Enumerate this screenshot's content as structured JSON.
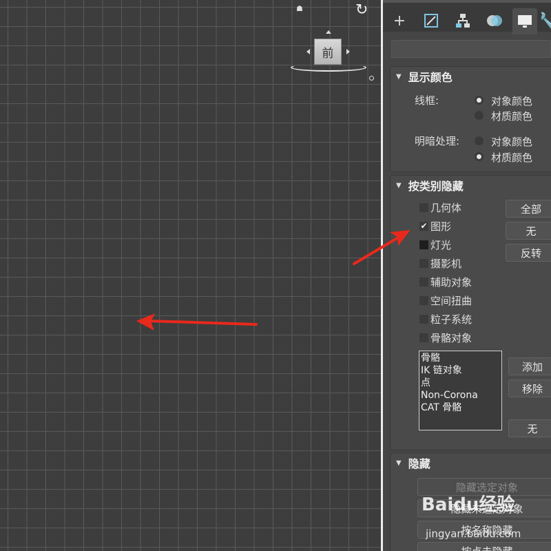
{
  "viewport": {
    "viewcube_face": "前"
  },
  "panel": {
    "display_color": {
      "title": "显示颜色",
      "wireframe_label": "线框:",
      "wireframe_options": [
        "对象颜色",
        "材质颜色"
      ],
      "wireframe_selected": 0,
      "shaded_label": "明暗处理:",
      "shaded_options": [
        "对象颜色",
        "材质颜色"
      ],
      "shaded_selected": 1
    },
    "hide_by_category": {
      "title": "按类别隐藏",
      "categories": [
        {
          "label": "几何体",
          "checked": false
        },
        {
          "label": "图形",
          "checked": true
        },
        {
          "label": "灯光",
          "checked": false
        },
        {
          "label": "摄影机",
          "checked": false
        },
        {
          "label": "辅助对象",
          "checked": false
        },
        {
          "label": "空间扭曲",
          "checked": false
        },
        {
          "label": "粒子系统",
          "checked": false
        },
        {
          "label": "骨骼对象",
          "checked": false
        }
      ],
      "all_button": "全部",
      "none_button": "无",
      "invert_button": "反转",
      "list_items": [
        "骨骼",
        "IK 链对象",
        "点",
        "Non-Corona",
        "CAT 骨骼"
      ],
      "add_button": "添加",
      "remove_button": "移除",
      "list_none_button": "无"
    },
    "hide": {
      "title": "隐藏",
      "hide_selected": "隐藏选定对象",
      "hide_unselected": "隐藏未选定对象",
      "hide_by_name": "按名称隐藏",
      "hide_by_hit": "按点击隐藏"
    }
  },
  "watermark": {
    "logo": "Baidu经验",
    "url": "jingyan.baidu.com"
  },
  "colors": {
    "viewport_bg": "#3d3d3d",
    "grid_line": "#5a5a5a",
    "panel_bg": "#454545",
    "annotation_arrow": "#e8291c"
  }
}
